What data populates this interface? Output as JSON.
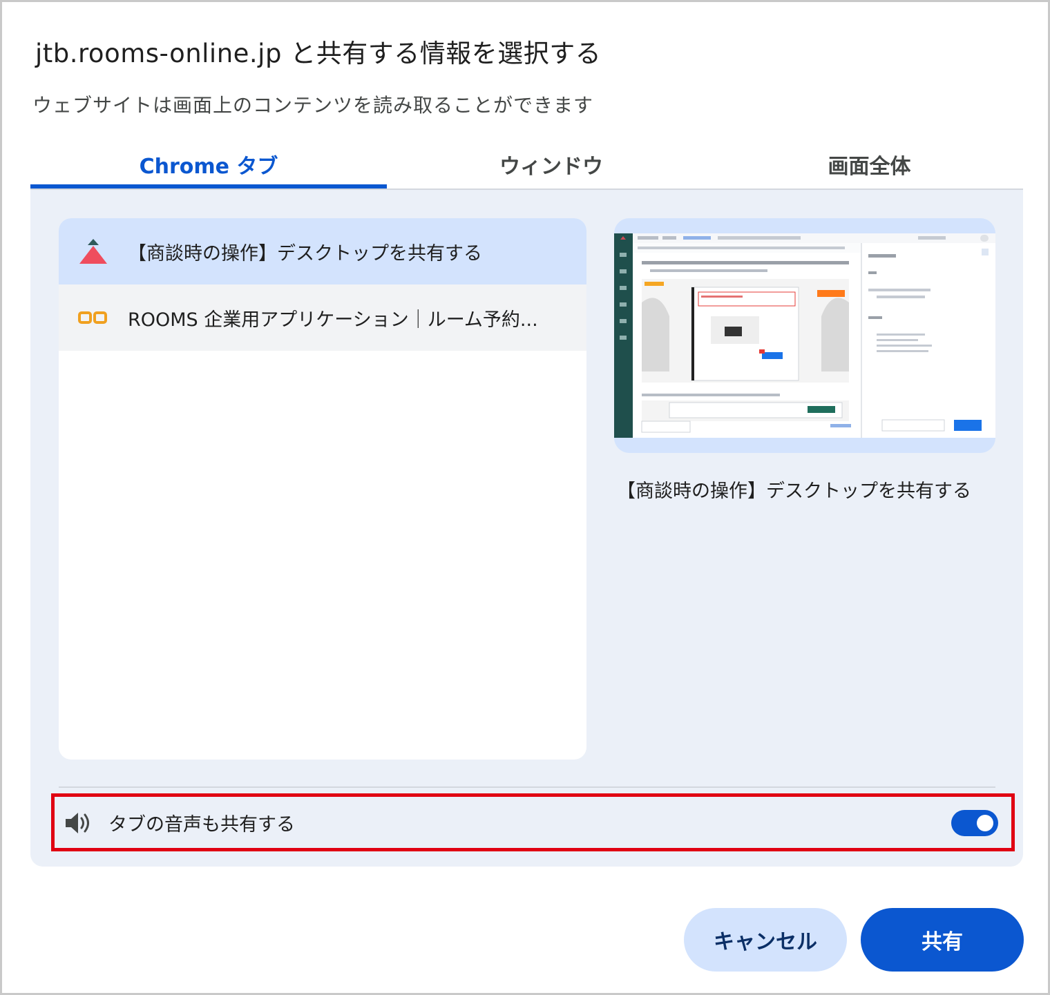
{
  "dialog": {
    "title": "jtb.rooms-online.jp と共有する情報を選択する",
    "subtitle": "ウェブサイトは画面上のコンテンツを読み取ることができます"
  },
  "tabs": [
    {
      "label": "Chrome タブ",
      "active": true
    },
    {
      "label": "ウィンドウ",
      "active": false
    },
    {
      "label": "画面全体",
      "active": false
    }
  ],
  "tab_list": [
    {
      "title": "【商談時の操作】デスクトップを共有する",
      "selected": true,
      "icon": "bell-logo-icon"
    },
    {
      "title": "ROOMS 企業用アプリケーション｜ルーム予約...",
      "selected": false,
      "icon": "rooms-logo-icon"
    }
  ],
  "preview": {
    "label": "【商談時の操作】デスクトップを共有する"
  },
  "audio": {
    "label": "タブの音声も共有する",
    "enabled": true
  },
  "buttons": {
    "cancel": "キャンセル",
    "share": "共有"
  },
  "colors": {
    "accent": "#0b57d0",
    "panel_bg": "#ebf0f8",
    "selected_bg": "#d3e3fd",
    "highlight_border": "#e00012"
  }
}
